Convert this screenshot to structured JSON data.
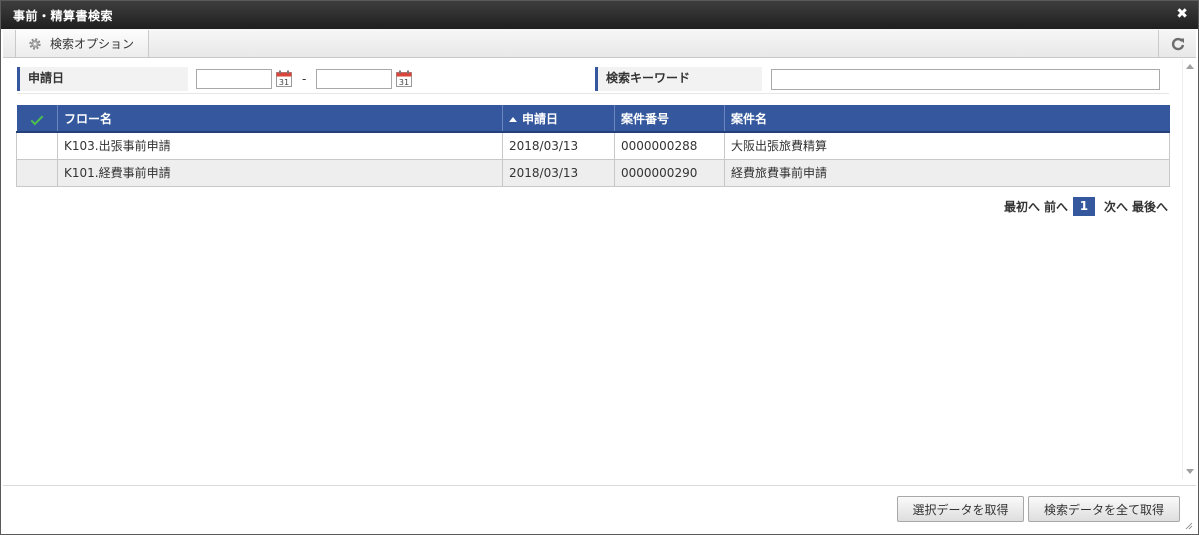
{
  "window": {
    "title": "事前・精算書検索",
    "close_glyph": "✖"
  },
  "toolbar": {
    "search_option_label": "検索オプション",
    "gear_icon": "gear-icon",
    "refresh_icon": "refresh-icon"
  },
  "search": {
    "date_label": "申請日",
    "date_from_value": "",
    "date_to_value": "",
    "date_separator": "-",
    "calendar_day": "31",
    "keyword_label": "検索キーワード",
    "keyword_value": ""
  },
  "table": {
    "columns": [
      "フロー名",
      "申請日",
      "案件番号",
      "案件名"
    ],
    "sorted_column": "申請日",
    "sort_direction": "ascending",
    "rows": [
      {
        "flow": "K103.出張事前申請",
        "date": "2018/03/13",
        "number": "0000000288",
        "name": "大阪出張旅費精算"
      },
      {
        "flow": "K101.経費事前申請",
        "date": "2018/03/13",
        "number": "0000000290",
        "name": "経費旅費事前申請"
      }
    ]
  },
  "pager": {
    "first": "最初へ",
    "prev": "前へ",
    "current": "1",
    "next": "次へ",
    "last": "最後へ"
  },
  "footer": {
    "select_button": "選択データを取得",
    "all_button": "検索データを全て取得"
  },
  "colors": {
    "header_blue": "#34579d",
    "check_green": "#4cc04c",
    "titlebar": "#2c2c2c",
    "calendar_red": "#d9453a"
  }
}
